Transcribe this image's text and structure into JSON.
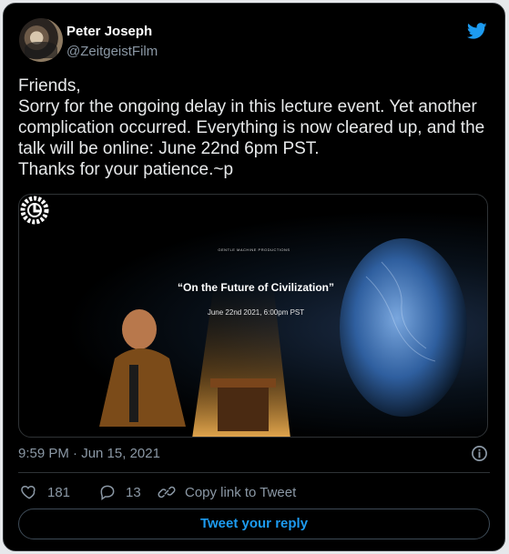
{
  "author": {
    "name": "Peter Joseph",
    "handle": "@ZeitgeistFilm"
  },
  "tweet": {
    "text": "Friends,\nSorry for the ongoing delay in this lecture event. Yet another complication occurred. Everything is now cleared up, and the talk will be online: June 22nd 6pm PST.\nThanks for your patience.~p",
    "timestamp": "9:59 PM · Jun 15, 2021"
  },
  "media": {
    "studio": "GENTLE MACHINE PRODUCTIONS",
    "title": "“On the Future of Civilization”",
    "date": "June 22nd 2021, 6:00pm PST"
  },
  "actions": {
    "likes": "181",
    "replies": "13",
    "copy_link": "Copy link to Tweet",
    "reply_button": "Tweet your reply"
  },
  "icons": [
    "twitter-bird-icon",
    "info-icon",
    "heart-icon",
    "reply-icon",
    "link-icon",
    "gear-logo-icon"
  ],
  "colors": {
    "background": "#000000",
    "accent": "#1d9bf0",
    "secondary_text": "#8b98a5",
    "twitter_brand": "#1d9bf0"
  }
}
